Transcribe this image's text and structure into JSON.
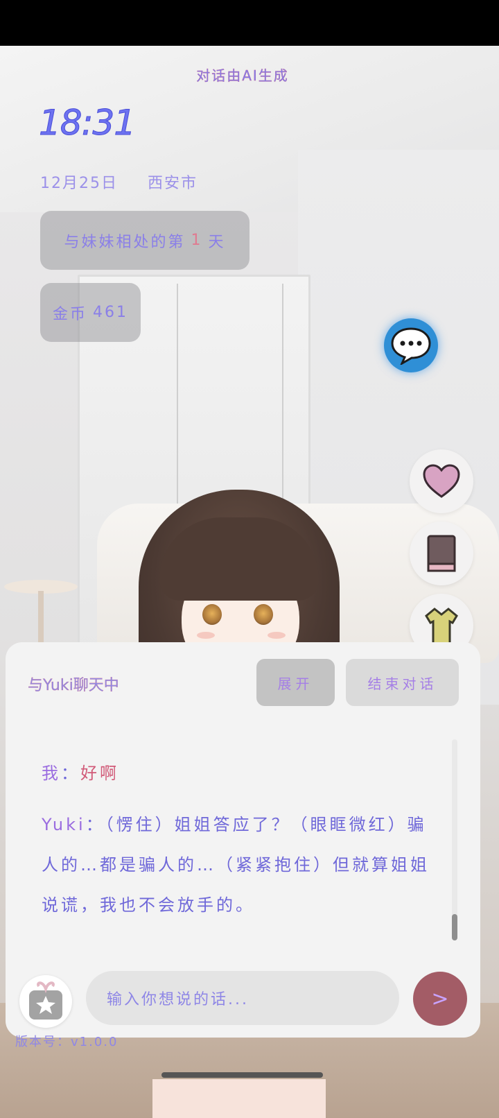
{
  "overlay": {
    "ai_note": "对话由AI生成",
    "time": "18:31",
    "date": "12月25日",
    "city": "西安市",
    "days_prefix": "与妹妹相处的第",
    "days_number": "1",
    "days_suffix": "天",
    "coins_label": "金币",
    "coins_value": "461"
  },
  "side_buttons": [
    {
      "icon": "chat-bubble-icon"
    },
    {
      "icon": "heart-icon"
    },
    {
      "icon": "book-icon"
    },
    {
      "icon": "shirt-icon"
    }
  ],
  "chat": {
    "title": "与Yuki聊天中",
    "expand_label": "展开",
    "end_label": "结束对话",
    "messages": [
      {
        "speaker": "我",
        "text": "好啊"
      },
      {
        "speaker": "Yuki",
        "text": "（愣住）姐姐答应了？（眼眶微红）骗人的…都是骗人的…（紧紧抱住）但就算姐姐说谎，我也不会放手的。"
      }
    ],
    "input_placeholder": "输入你想说的话...",
    "send_symbol": ">",
    "gift_icon": "gift-star-icon"
  },
  "version_text": "版本号：v1.0.0",
  "colors": {
    "accent_text": "#8f87e6",
    "chat_bubble_button": "#2f8fd6",
    "send_button": "#a35c66",
    "heart": "#d59ec0"
  }
}
